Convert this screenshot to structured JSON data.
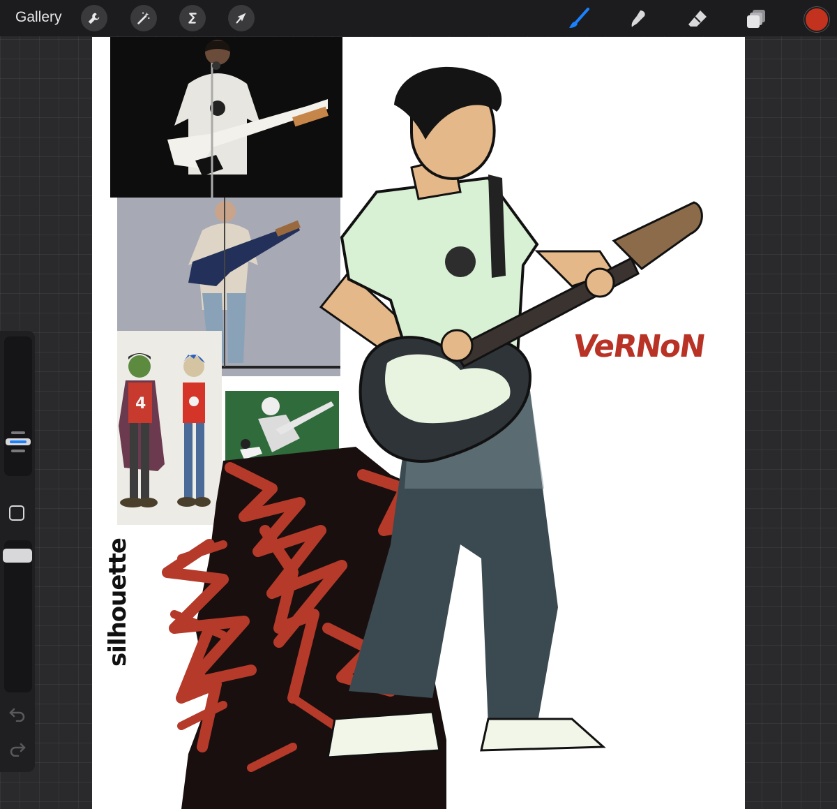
{
  "app": {
    "gallery_label": "Gallery",
    "current_color": "#c2321f",
    "accent_color": "#1a82ff"
  },
  "toolbar_left": [
    {
      "icon": "wrench-icon",
      "label": "Actions"
    },
    {
      "icon": "magic-wand-icon",
      "label": "Adjustments"
    },
    {
      "icon": "selection-icon",
      "label": "Selection"
    },
    {
      "icon": "transform-arrow-icon",
      "label": "Transform"
    }
  ],
  "toolbar_right": [
    {
      "icon": "brush-icon",
      "label": "Paint",
      "active": true
    },
    {
      "icon": "smudge-icon",
      "label": "Smudge",
      "active": false
    },
    {
      "icon": "eraser-icon",
      "label": "Erase",
      "active": false
    },
    {
      "icon": "layers-icon",
      "label": "Layers",
      "active": false
    }
  ],
  "sidebar": {
    "brush_size_level": 0.72,
    "opacity_level": 0.96,
    "icons": [
      "modify-square-icon",
      "undo-icon",
      "redo-icon"
    ]
  },
  "canvas": {
    "handwritten_name": "VeRNoN",
    "handwritten_side": "silhouette"
  }
}
